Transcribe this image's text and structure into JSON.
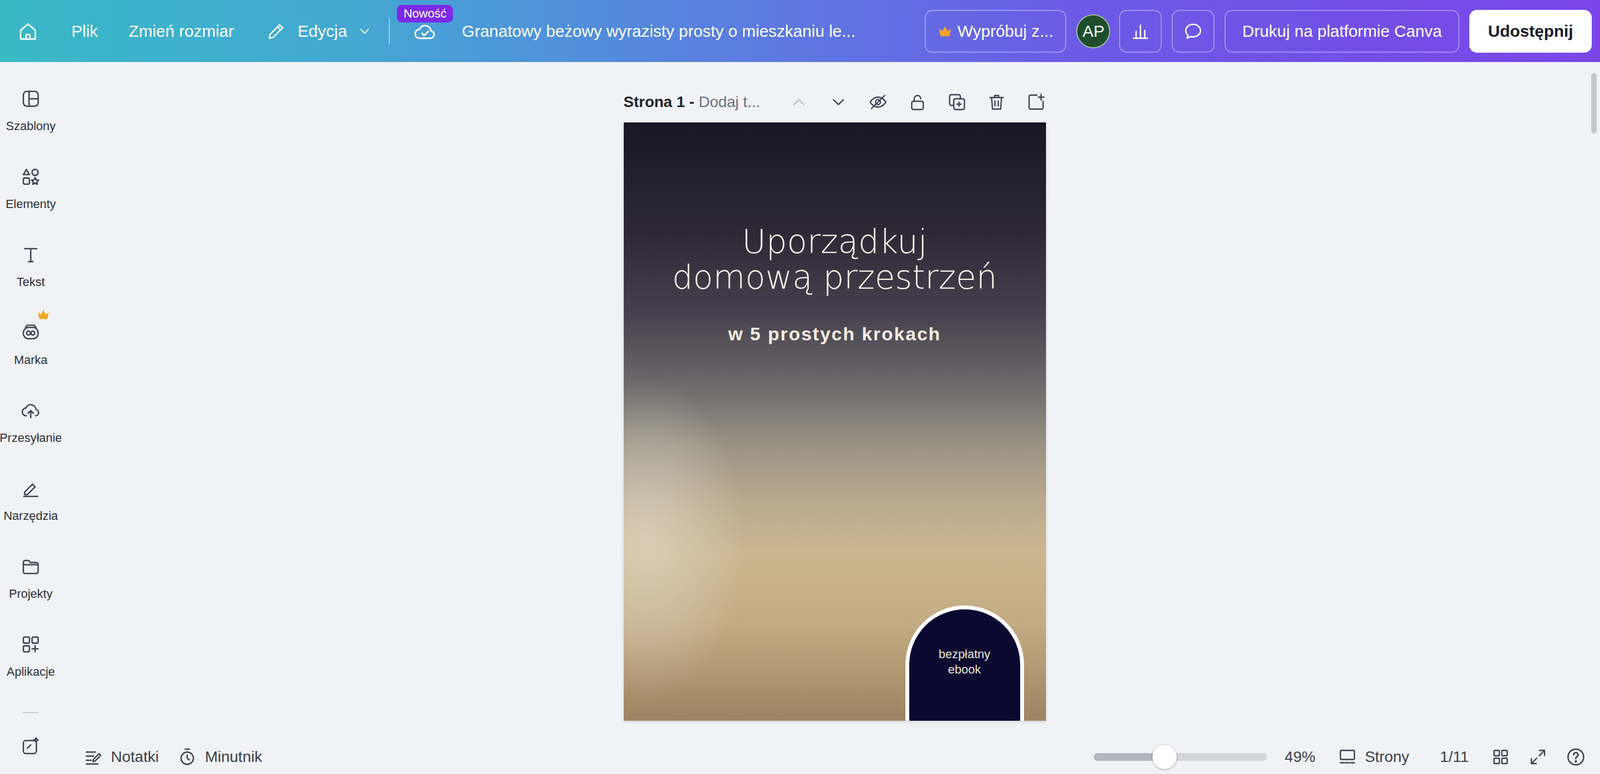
{
  "topbar": {
    "menu": [
      "Plik",
      "Zmień rozmiar"
    ],
    "edit_menu": "Edycja",
    "badge": "Nowość",
    "title": "Granatowy beżowy wyrazisty prosty o mieszkaniu le...",
    "trial_button": "Wypróbuj z...",
    "avatar": "AP",
    "print_button": "Drukuj na platformie Canva",
    "share_button": "Udostępnij"
  },
  "sidebar": {
    "items": [
      {
        "label": "Szablony",
        "premium": false
      },
      {
        "label": "Elementy",
        "premium": false
      },
      {
        "label": "Tekst",
        "premium": false
      },
      {
        "label": "Marka",
        "premium": true
      },
      {
        "label": "Przesyłanie",
        "premium": false
      },
      {
        "label": "Narzędzia",
        "premium": false
      },
      {
        "label": "Projekty",
        "premium": false
      },
      {
        "label": "Aplikacje",
        "premium": false
      }
    ]
  },
  "page_header": {
    "label": "Strona 1 -",
    "title_placeholder": "Dodaj t...",
    "up_disabled": true
  },
  "page": {
    "title": [
      "Uporządkuj",
      "domową przestrzeń"
    ],
    "subtitle": "w 5 prostych krokach",
    "badge": [
      "bezpłatny",
      "ebook"
    ]
  },
  "bottom_bar": {
    "notes": "Notatki",
    "timer": "Minutnik",
    "zoom": {
      "level": 0.41,
      "reading": "49%"
    },
    "pages": "Strony",
    "page_count": "1/11"
  }
}
